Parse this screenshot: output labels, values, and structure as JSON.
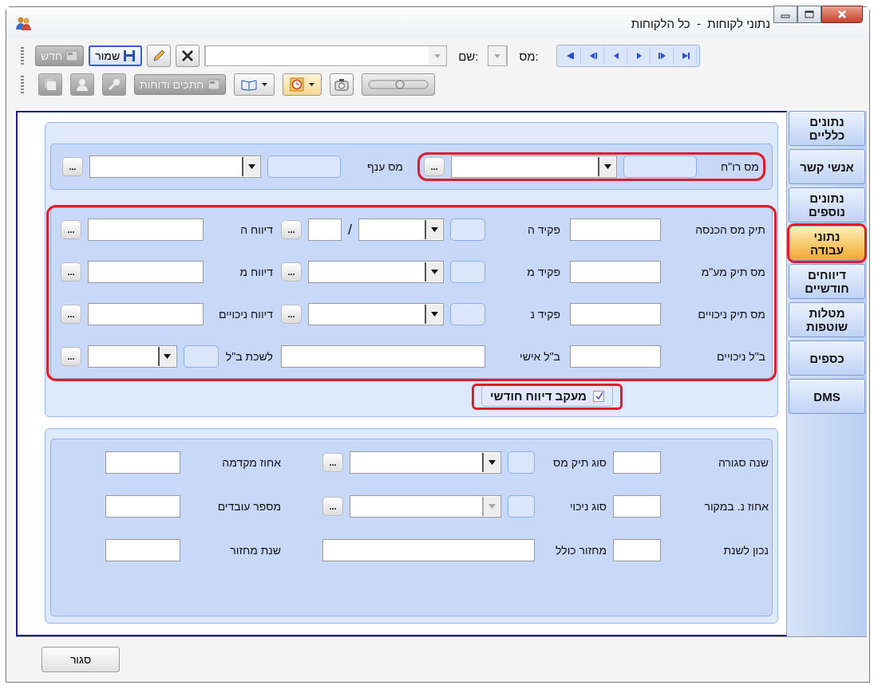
{
  "window": {
    "title": "נתוני לקוחות  -  כל הלקוחות"
  },
  "toolbar": {
    "rows": [
      {
        "items": [
          {
            "kind": "nav",
            "buttons": [
              {
                "kind": "first"
              },
              {
                "kind": "prev-page"
              },
              {
                "kind": "prev"
              },
              {
                "kind": "next"
              },
              {
                "kind": "next-page"
              },
              {
                "kind": "last"
              }
            ]
          },
          {
            "kind": "label",
            "text": "מס:"
          },
          {
            "kind": "combo",
            "disabled": true
          },
          {
            "kind": "label",
            "text": "שם:"
          },
          {
            "kind": "combo",
            "disabled": true
          },
          {
            "kind": "clear",
            "disabled": false
          },
          {
            "kind": "edit",
            "disabled": false
          },
          {
            "kind": "save",
            "text": "שמור",
            "disabled": false,
            "focused": true
          },
          {
            "kind": "new",
            "text": "חדש",
            "disabled": true,
            "focused": false
          },
          {
            "kind": "grip"
          }
        ]
      },
      {
        "items": [
          {
            "kind": "my",
            "disabled": true
          },
          {
            "kind": "camera",
            "disabled": false
          },
          {
            "kind": "clock-menu",
            "disabled": false
          },
          {
            "kind": "book-menu",
            "disabled": false
          },
          {
            "kind": "reports",
            "text": "חתכים ודוחות",
            "disabled": true,
            "focused": false
          },
          {
            "kind": "key",
            "disabled": true
          },
          {
            "kind": "person",
            "disabled": true
          },
          {
            "kind": "stack",
            "disabled": true
          },
          {
            "kind": "grip"
          }
        ]
      }
    ]
  },
  "tabs": [
    {
      "label": "נתונים כלליים",
      "selected": false,
      "highlighted": false
    },
    {
      "label": "אנשי קשר",
      "selected": false,
      "highlighted": false
    },
    {
      "label": "נתונים נוספים",
      "selected": false,
      "highlighted": false
    },
    {
      "label": "נתוני עבודה",
      "selected": true,
      "highlighted": true
    },
    {
      "label": "דיווחים חודשיים",
      "selected": false,
      "highlighted": false
    },
    {
      "label": "מטלות שוטפות",
      "selected": false,
      "highlighted": false
    },
    {
      "label": "כספים",
      "selected": false,
      "highlighted": false
    },
    {
      "label": "DMS",
      "selected": false,
      "highlighted": false
    }
  ],
  "top_section": {
    "groups": [
      {
        "highlighted": true,
        "cells": [
          {
            "kind": "label",
            "text": "מס רו\"ח"
          },
          {
            "kind": "box"
          },
          {
            "kind": "combo",
            "disabled": false
          },
          {
            "kind": "ellipsis",
            "text": "..."
          }
        ]
      },
      {
        "cells": [
          {
            "kind": "label",
            "text": "מס ענף"
          },
          {
            "kind": "box"
          },
          {
            "kind": "combo",
            "disabled": false
          },
          {
            "kind": "ellipsis",
            "text": "..."
          }
        ]
      }
    ]
  },
  "work_section": {
    "highlighted": true,
    "rows": [
      {
        "groups": [
          {
            "cells": [
              {
                "kind": "label",
                "text": "תיק מס הכנסה"
              },
              {
                "kind": "text"
              }
            ]
          },
          {
            "cells": [
              {
                "kind": "label",
                "text": "פקיד ה"
              },
              {
                "kind": "box"
              },
              {
                "kind": "combo",
                "disabled": false
              },
              {
                "kind": "slash",
                "text": "/"
              },
              {
                "kind": "short-text"
              },
              {
                "kind": "ellipsis",
                "text": "..."
              }
            ]
          },
          {
            "cells": [
              {
                "kind": "label",
                "text": "דיווח ה"
              },
              {
                "kind": "text"
              },
              {
                "kind": "ellipsis",
                "text": "..."
              }
            ]
          }
        ]
      },
      {
        "groups": [
          {
            "cells": [
              {
                "kind": "label",
                "text": "מס תיק מע\"מ"
              },
              {
                "kind": "text"
              }
            ]
          },
          {
            "cells": [
              {
                "kind": "label",
                "text": "פקיד מ"
              },
              {
                "kind": "box"
              },
              {
                "kind": "combo",
                "disabled": false
              },
              {
                "kind": "ellipsis",
                "text": "..."
              }
            ]
          },
          {
            "cells": [
              {
                "kind": "label",
                "text": "דיווח מ"
              },
              {
                "kind": "text"
              },
              {
                "kind": "ellipsis",
                "text": "..."
              }
            ]
          }
        ]
      },
      {
        "groups": [
          {
            "cells": [
              {
                "kind": "label",
                "text": "מס תיק ניכויים"
              },
              {
                "kind": "text"
              }
            ]
          },
          {
            "cells": [
              {
                "kind": "label",
                "text": "פקיד נ"
              },
              {
                "kind": "box"
              },
              {
                "kind": "combo",
                "disabled": false
              },
              {
                "kind": "ellipsis",
                "text": "..."
              }
            ]
          },
          {
            "cells": [
              {
                "kind": "label",
                "text": "דיווח ניכויים"
              },
              {
                "kind": "text"
              },
              {
                "kind": "ellipsis",
                "text": "..."
              }
            ]
          }
        ]
      },
      {
        "groups": [
          {
            "cells": [
              {
                "kind": "label",
                "text": "ב\"ל ניכויים"
              },
              {
                "kind": "text"
              }
            ]
          },
          {
            "cells": [
              {
                "kind": "label",
                "text": "ב\"ל אישי"
              },
              {
                "kind": "wide-text"
              }
            ]
          },
          {
            "cells": [
              {
                "kind": "label",
                "text": "לשכת ב\"ל"
              },
              {
                "kind": "box"
              },
              {
                "kind": "combo",
                "disabled": false
              },
              {
                "kind": "ellipsis",
                "text": "..."
              }
            ]
          }
        ]
      }
    ]
  },
  "monthly_tracking": {
    "label": "מעקב דיווח חודשי",
    "checked": true,
    "highlighted": true
  },
  "details_section": {
    "rows": [
      {
        "groups": [
          {
            "cells": [
              {
                "kind": "label",
                "text": "שנה סגורה"
              },
              {
                "kind": "text"
              }
            ]
          },
          {
            "cells": [
              {
                "kind": "label",
                "text": "סוג תיק מס"
              },
              {
                "kind": "box"
              },
              {
                "kind": "combo",
                "disabled": false
              },
              {
                "kind": "ellipsis",
                "text": "..."
              }
            ]
          },
          {
            "cells": [
              {
                "kind": "label",
                "text": "אחוז מקדמה"
              },
              {
                "kind": "text"
              }
            ]
          }
        ]
      },
      {
        "groups": [
          {
            "cells": [
              {
                "kind": "label",
                "text": "אחוז נ. במקור"
              },
              {
                "kind": "text"
              }
            ]
          },
          {
            "cells": [
              {
                "kind": "label",
                "text": "סוג ניכוי"
              },
              {
                "kind": "box"
              },
              {
                "kind": "combo",
                "disabled": true
              },
              {
                "kind": "ellipsis",
                "text": "..."
              }
            ]
          },
          {
            "cells": [
              {
                "kind": "label",
                "text": "מספר עובדים"
              },
              {
                "kind": "text"
              }
            ]
          }
        ]
      },
      {
        "groups": [
          {
            "cells": [
              {
                "kind": "label",
                "text": "נכון לשנת"
              },
              {
                "kind": "text"
              }
            ]
          },
          {
            "cells": [
              {
                "kind": "label",
                "text": "מחזור כולל"
              },
              {
                "kind": "wide-text"
              }
            ]
          },
          {
            "cells": [
              {
                "kind": "label",
                "text": "שנת מחזור"
              },
              {
                "kind": "text"
              }
            ]
          }
        ]
      }
    ]
  },
  "close_button": {
    "text": "סגור"
  }
}
